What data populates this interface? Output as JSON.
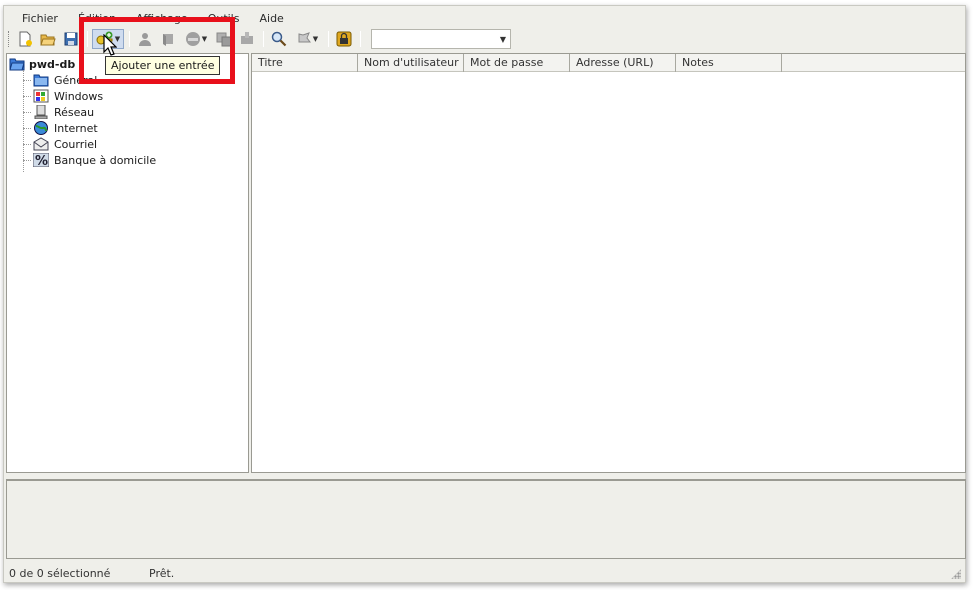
{
  "menu": [
    "Fichier",
    "Édition",
    "Affichage",
    "Outils",
    "Aide"
  ],
  "toolbar": {
    "buttons": [
      "new-database-icon",
      "open-database-icon",
      "save-database-icon",
      "add-entry-icon",
      "edit-entry-icon",
      "delete-entry-icon",
      "copy-username-icon",
      "copy-password-icon",
      "open-url-icon",
      "find-icon",
      "tools-icon",
      "lock-icon"
    ],
    "search_value": ""
  },
  "tooltip": "Ajouter une entrée",
  "tree": {
    "root": "pwd-db",
    "groups": [
      "Général",
      "Windows",
      "Réseau",
      "Internet",
      "Courriel",
      "Banque à domicile"
    ]
  },
  "columns": [
    "Titre",
    "Nom d'utilisateur",
    "Mot de passe",
    "Adresse (URL)",
    "Notes"
  ],
  "status": {
    "count": "0 de 0 sélectionné",
    "state": "Prêt."
  },
  "colors": {
    "highlight": "#e8101b",
    "tooltip_bg": "#ffffe1"
  }
}
